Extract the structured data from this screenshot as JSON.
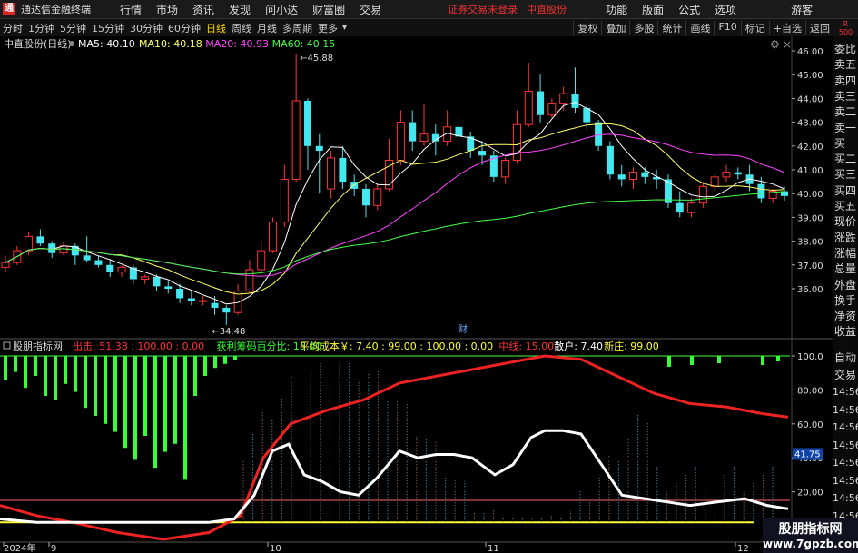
{
  "menubar": {
    "app_title": "通达信金融终端",
    "items": [
      "行情",
      "市场",
      "资讯",
      "发现",
      "问小达",
      "财富圈",
      "交易"
    ],
    "broker_warning": "证券交易未登录",
    "stock_link": "中直股份",
    "right_items": [
      "功能",
      "版面",
      "公式",
      "选项"
    ],
    "guest": "游客"
  },
  "toolbar": {
    "timeframes": [
      "分时",
      "1分钟",
      "5分钟",
      "15分钟",
      "30分钟",
      "60分钟",
      "日线",
      "周线",
      "月线",
      "多周期",
      "更多"
    ],
    "active": "日线",
    "right_buttons": [
      "复权",
      "叠加",
      "多股",
      "统计",
      "画线",
      "F10",
      "标记",
      "+自选",
      "返回"
    ],
    "corner_label": "R",
    "corner_value": "500"
  },
  "main_chart": {
    "title": "中直股份(日线)",
    "ma": [
      {
        "label": "MA5: 40.10",
        "color": "#ffffff"
      },
      {
        "label": "MA10: 40.18",
        "color": "#ffff66"
      },
      {
        "label": "MA20: 40.93",
        "color": "#ff44ff"
      },
      {
        "label": "MA60: 40.15",
        "color": "#44ff44"
      }
    ],
    "high_label": "45.88",
    "low_label": "34.48",
    "finance_marker": "财",
    "y_ticks": [
      "46.00",
      "45.00",
      "44.00",
      "43.00",
      "42.00",
      "41.00",
      "40.00",
      "39.00",
      "38.00",
      "37.00",
      "36.00"
    ]
  },
  "indicator": {
    "title": "股朋指标网",
    "values": [
      {
        "label": "出击: 51.38 : 100.00 : 0.00",
        "color": "#ff3333"
      },
      {
        "label": "获利筹码百分比: 15.00",
        "color": "#33ff33"
      },
      {
        "label": "平均成本￥: 7.40 : 99.00 : 100.00 : 0.00",
        "color": "#ffff33"
      },
      {
        "label": "中线: 15.00",
        "color": "#ff3333"
      },
      {
        "label": "散户: 7.40",
        "color": "#ffffff"
      },
      {
        "label": "新庄: 99.00",
        "color": "#ffff33"
      }
    ],
    "y_ticks": [
      "100.0",
      "80.00",
      "60.00",
      "40.00",
      "20.00"
    ],
    "current_value": "41.75"
  },
  "x_axis": {
    "labels": [
      "2024年",
      "9",
      "10",
      "11",
      "12"
    ]
  },
  "right_panel": {
    "items": [
      "委比",
      "卖五",
      "卖四",
      "卖三",
      "卖二",
      "卖一",
      "买一",
      "买二",
      "买三",
      "买四",
      "买五",
      "现价",
      "涨跌",
      "涨幅",
      "总量",
      "外盘",
      "换手",
      "净资",
      "收益",
      "自动",
      "交易"
    ],
    "time_labels": [
      "14:56",
      "14:56",
      "14:56",
      "14:56",
      "14:56",
      "14:56",
      "14:56",
      "14:56"
    ]
  },
  "watermark": {
    "line1": "股朋指标网",
    "line2": "www.7gpzb.com"
  },
  "chart_data": {
    "type": "candlestick",
    "candles": [
      [
        36.9,
        37.4,
        37.1,
        36.7
      ],
      [
        37.1,
        37.8,
        37.6,
        37.0
      ],
      [
        37.6,
        38.4,
        38.2,
        37.4
      ],
      [
        38.2,
        38.5,
        37.9,
        37.8
      ],
      [
        37.9,
        38.0,
        37.5,
        37.3
      ],
      [
        37.5,
        38.0,
        37.8,
        37.4
      ],
      [
        37.8,
        37.9,
        37.4,
        37.0
      ],
      [
        37.4,
        38.2,
        37.2,
        37.1
      ],
      [
        37.2,
        37.4,
        37.0,
        36.9
      ],
      [
        37.0,
        37.2,
        36.7,
        36.5
      ],
      [
        36.7,
        37.0,
        36.9,
        36.5
      ],
      [
        36.9,
        37.0,
        36.4,
        36.2
      ],
      [
        36.4,
        36.6,
        36.5,
        36.2
      ],
      [
        36.5,
        36.6,
        36.1,
        35.9
      ],
      [
        36.1,
        36.3,
        36.0,
        35.8
      ],
      [
        36.0,
        36.2,
        35.6,
        35.4
      ],
      [
        35.6,
        35.9,
        35.5,
        35.3
      ],
      [
        35.5,
        35.7,
        35.5,
        35.3
      ],
      [
        35.4,
        35.7,
        35.2,
        34.9
      ],
      [
        35.2,
        35.3,
        35.0,
        34.48
      ],
      [
        35.0,
        36.2,
        35.9,
        34.9
      ],
      [
        35.9,
        37.2,
        36.8,
        35.8
      ],
      [
        36.8,
        38.0,
        37.6,
        36.6
      ],
      [
        37.6,
        39.0,
        38.8,
        37.5
      ],
      [
        38.8,
        41.2,
        40.6,
        38.6
      ],
      [
        40.6,
        45.88,
        43.9,
        40.5
      ],
      [
        43.9,
        44.0,
        42.0,
        41.0
      ],
      [
        42.0,
        42.5,
        41.8,
        40.0
      ],
      [
        40.2,
        41.8,
        41.5,
        39.8
      ],
      [
        41.5,
        42.0,
        40.5,
        40.2
      ],
      [
        40.5,
        40.8,
        40.2,
        39.9
      ],
      [
        40.2,
        40.4,
        39.5,
        39.0
      ],
      [
        39.5,
        40.4,
        40.2,
        39.3
      ],
      [
        40.2,
        42.3,
        41.4,
        40.1
      ],
      [
        41.4,
        43.5,
        43.0,
        41.2
      ],
      [
        43.0,
        43.5,
        42.2,
        41.8
      ],
      [
        42.2,
        43.8,
        42.5,
        42.0
      ],
      [
        42.5,
        42.9,
        42.2,
        41.6
      ],
      [
        42.2,
        43.5,
        42.8,
        42.0
      ],
      [
        42.8,
        43.2,
        42.4,
        41.9
      ],
      [
        42.4,
        42.6,
        41.8,
        41.5
      ],
      [
        41.8,
        42.2,
        41.6,
        41.2
      ],
      [
        41.6,
        41.8,
        40.7,
        40.5
      ],
      [
        40.7,
        41.5,
        41.4,
        40.4
      ],
      [
        41.4,
        43.5,
        42.9,
        41.3
      ],
      [
        42.9,
        45.5,
        44.3,
        42.8
      ],
      [
        44.3,
        45.0,
        43.3,
        43.0
      ],
      [
        43.3,
        44.0,
        43.8,
        43.2
      ],
      [
        43.8,
        44.5,
        44.2,
        43.5
      ],
      [
        44.2,
        45.3,
        43.6,
        43.4
      ],
      [
        43.6,
        43.8,
        43.0,
        42.7
      ],
      [
        43.0,
        43.1,
        42.0,
        41.8
      ],
      [
        42.0,
        42.2,
        40.8,
        40.6
      ],
      [
        40.8,
        41.2,
        40.6,
        40.3
      ],
      [
        40.6,
        41.1,
        40.9,
        40.2
      ],
      [
        40.9,
        41.1,
        40.7,
        40.4
      ],
      [
        40.7,
        41.0,
        40.6,
        40.2
      ],
      [
        40.6,
        40.8,
        39.6,
        39.4
      ],
      [
        39.6,
        40.1,
        39.2,
        39.0
      ],
      [
        39.2,
        39.8,
        39.6,
        39.0
      ],
      [
        39.6,
        40.5,
        40.3,
        39.4
      ],
      [
        40.3,
        40.8,
        40.7,
        40.1
      ],
      [
        40.7,
        41.2,
        40.9,
        40.5
      ],
      [
        40.9,
        41.1,
        40.8,
        40.6
      ],
      [
        40.8,
        41.2,
        40.4,
        40.1
      ],
      [
        40.4,
        40.7,
        39.8,
        39.6
      ],
      [
        39.8,
        40.2,
        40.1,
        39.6
      ],
      [
        40.1,
        40.3,
        39.9,
        39.7
      ]
    ]
  }
}
